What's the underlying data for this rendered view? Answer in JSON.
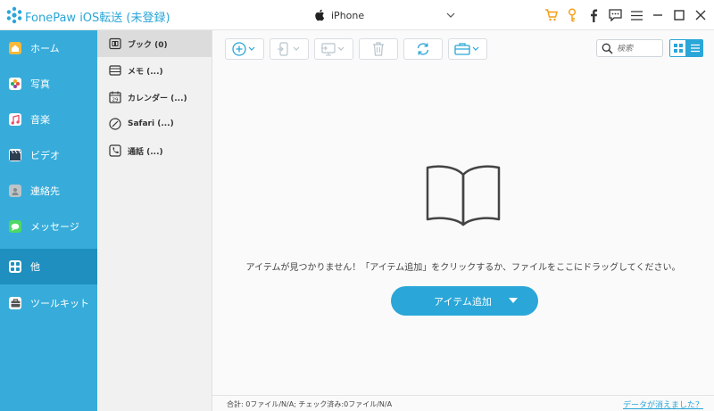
{
  "app": {
    "title": "FonePaw iOS転送 (未登録)",
    "device_name": "iPhone"
  },
  "colors": {
    "accent": "#2aa6d8",
    "sidebar_bg": "#37acda",
    "sidebar_active": "#1e8fbe",
    "cart": "#f39c12"
  },
  "titlebar_icons": [
    "cart-icon",
    "key-icon",
    "facebook-icon",
    "feedback-icon",
    "menu-icon",
    "minimize-icon",
    "maximize-icon",
    "close-icon"
  ],
  "sidebar": {
    "items": [
      {
        "label": "ホーム",
        "icon": "home-icon",
        "active": false
      },
      {
        "label": "写真",
        "icon": "photos-icon",
        "active": false
      },
      {
        "label": "音楽",
        "icon": "music-icon",
        "active": false
      },
      {
        "label": "ビデオ",
        "icon": "video-icon",
        "active": false
      },
      {
        "label": "連絡先",
        "icon": "contacts-icon",
        "active": false
      },
      {
        "label": "メッセージ",
        "icon": "messages-icon",
        "active": false
      },
      {
        "label": "他",
        "icon": "other-icon",
        "active": true
      },
      {
        "label": "ツールキット",
        "icon": "toolkit-icon",
        "active": false
      }
    ]
  },
  "subpanel": {
    "items": [
      {
        "label": "ブック (0)",
        "icon": "book-icon",
        "active": true
      },
      {
        "label": "メモ (...)",
        "icon": "notes-icon",
        "active": false
      },
      {
        "label": "カレンダー (...)",
        "icon": "calendar-icon",
        "active": false
      },
      {
        "label": "Safari (...)",
        "icon": "safari-icon",
        "active": false
      },
      {
        "label": "通話 (...)",
        "icon": "call-icon",
        "active": false
      }
    ]
  },
  "toolbar": {
    "buttons": [
      "add-icon",
      "export-device-icon",
      "export-pc-icon",
      "delete-icon",
      "refresh-icon",
      "toolbox-icon"
    ],
    "search_placeholder": "検索"
  },
  "main": {
    "empty_message": "アイテムが見つかりません！「アイテム追加」をクリックするか、ファイルをここにドラッグしてください。",
    "add_button_label": "アイテム追加"
  },
  "status": {
    "summary": "合計: 0ファイル/N/A; チェック済み:0ファイル/N/A",
    "lost_data_link": "データが消えました？"
  }
}
